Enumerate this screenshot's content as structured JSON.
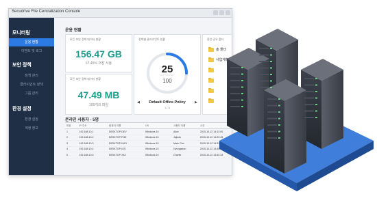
{
  "window": {
    "title": "Secudrive File Centralization Console"
  },
  "sidebar": {
    "sections": [
      {
        "title": "모니터링",
        "items": [
          {
            "label": "운용 현황",
            "active": true
          },
          {
            "label": "이벤트 및 로그",
            "active": false
          }
        ]
      },
      {
        "title": "보안 정책",
        "items": [
          {
            "label": "정책 관리",
            "active": false
          },
          {
            "label": "클라이언트 정책",
            "active": false
          },
          {
            "label": "그룹 관리",
            "active": false
          }
        ]
      },
      {
        "title": "환경 설정",
        "items": [
          {
            "label": "환경 설정",
            "active": false
          },
          {
            "label": "계정 정보",
            "active": false
          }
        ]
      }
    ]
  },
  "overview": {
    "heading": "운용 현황",
    "card1": {
      "label": "모든 보안 정책 데이터 현황",
      "value": "156.47 GB",
      "sub": "67.45% 저장 사용"
    },
    "card2": {
      "label": "모든 보안 정책 데이터 현황",
      "value": "47.49 MB",
      "sub": "105개의 파일"
    },
    "policy": {
      "label": "정책별 클라이언트 현황",
      "count": "25",
      "total": "100",
      "fill": 0.25,
      "name": "Default Office Policy",
      "pager": "1 / 5"
    },
    "files": {
      "label": "중앙 공유 폴더",
      "items": [
        "총 폴더",
        "사업계획",
        "",
        "",
        "",
        ""
      ]
    }
  },
  "users": {
    "heading": "온라인 사용자 - 5명",
    "columns": [
      "번호",
      "IP 주소",
      "컴퓨터 이름",
      "OS",
      "사용자 이름",
      "시간"
    ],
    "rows": [
      [
        "1",
        "192.168.10.1",
        "DESKTOP-DEV",
        "Windows 10",
        "Alice",
        "2015-10-12 14:12:00"
      ],
      [
        "2",
        "192.168.10.2",
        "DESKTOP-PJM",
        "Windows 10",
        "Jsjiuds",
        "2015-10-12 14:23:45"
      ],
      [
        "3",
        "192.168.10.3",
        "DESKTOP-KWY",
        "Windows 10",
        "Mark Cho",
        "2015-10-12 14:31:02"
      ],
      [
        "4",
        "192.168.10.4",
        "DESKTOP-IOS",
        "Windows 10",
        "Gyungseon",
        "2015-10-12 14:40:18"
      ],
      [
        "5",
        "192.168.10.5",
        "DESKTOP-XKJ",
        "Windows 10",
        "Charlie",
        "2015-10-12 14:52:33"
      ]
    ]
  },
  "colors": {
    "sidebar": "#1f2f45",
    "accent": "#2c7be5",
    "value": "#1a9e8c",
    "folder": "#f3c843"
  }
}
